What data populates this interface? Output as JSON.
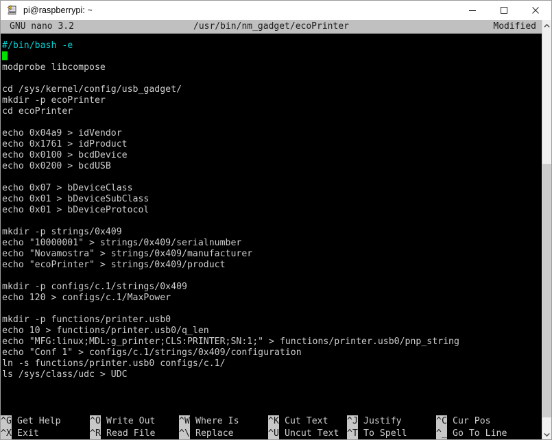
{
  "window": {
    "title": "pi@raspberrypi: ~",
    "icon": "putty-terminal-icon",
    "controls": {
      "minimize": "minimize-icon",
      "maximize": "maximize-icon",
      "close": "close-icon"
    }
  },
  "nano": {
    "version": "GNU nano 3.2",
    "filename": "/usr/bin/nm_gadget/ecoPrinter",
    "status": "Modified"
  },
  "editor": {
    "lines": [
      "#/bin/bash -e",
      "",
      "modprobe libcompose",
      "",
      "cd /sys/kernel/config/usb_gadget/",
      "mkdir -p ecoPrinter",
      "cd ecoPrinter",
      "",
      "echo 0x04a9 > idVendor",
      "echo 0x1761 > idProduct",
      "echo 0x0100 > bcdDevice",
      "echo 0x0200 > bcdUSB",
      "",
      "echo 0x07 > bDeviceClass",
      "echo 0x01 > bDeviceSubClass",
      "echo 0x01 > bDeviceProtocol",
      "",
      "mkdir -p strings/0x409",
      "echo \"10000001\" > strings/0x409/serialnumber",
      "echo \"Novamostra\" > strings/0x409/manufacturer",
      "echo \"ecoPrinter\" > strings/0x409/product",
      "",
      "mkdir -p configs/c.1/strings/0x409",
      "echo 120 > configs/c.1/MaxPower",
      "",
      "mkdir -p functions/printer.usb0",
      "echo 10 > functions/printer.usb0/q_len",
      "echo \"MFG:linux;MDL:g_printer;CLS:PRINTER;SN:1;\" > functions/printer.usb0/pnp_string",
      "echo \"Conf 1\" > configs/c.1/strings/0x409/configuration",
      "ln -s functions/printer.usb0 configs/c.1/",
      "ls /sys/class/udc > UDC"
    ],
    "shebang_line_index": 0,
    "cursor_line_index": 1,
    "colors": {
      "background": "#000000",
      "foreground": "#cdcdcd",
      "shebang": "#00cdcd",
      "cursor": "#00e000"
    }
  },
  "shortcuts": [
    {
      "key": "^G",
      "label": "Get Help",
      "key2": "^X",
      "label2": "Exit"
    },
    {
      "key": "^O",
      "label": "Write Out",
      "key2": "^R",
      "label2": "Read File"
    },
    {
      "key": "^W",
      "label": "Where Is",
      "key2": "^\\",
      "label2": "Replace"
    },
    {
      "key": "^K",
      "label": "Cut Text",
      "key2": "^U",
      "label2": "Uncut Text"
    },
    {
      "key": "^J",
      "label": "Justify",
      "key2": "^T",
      "label2": "To Spell"
    },
    {
      "key": "^C",
      "label": "Cur Pos",
      "key2": "^_",
      "label2": "Go To Line"
    }
  ],
  "scrollbar": {
    "up_arrow": "chevron-up-icon",
    "down_arrow": "chevron-down-icon"
  }
}
